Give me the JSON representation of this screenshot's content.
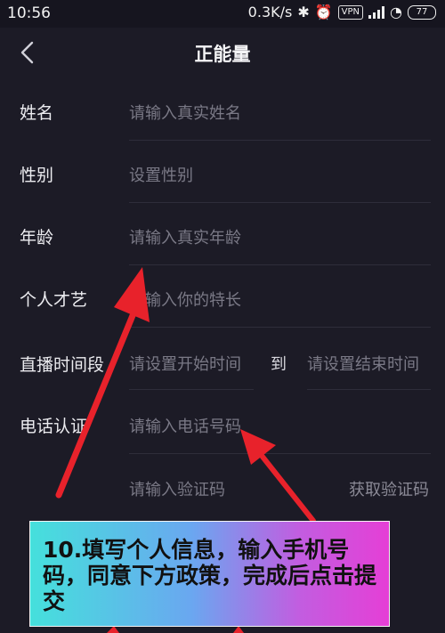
{
  "status_bar": {
    "time": "10:56",
    "speed": "0.3K/s",
    "vpn": "VPN",
    "battery": "77"
  },
  "header": {
    "title": "正能量"
  },
  "form": {
    "name": {
      "label": "姓名",
      "placeholder": "请输入真实姓名"
    },
    "gender": {
      "label": "性别",
      "placeholder": "设置性别"
    },
    "age": {
      "label": "年龄",
      "placeholder": "请输入真实年龄"
    },
    "talent": {
      "label": "个人才艺",
      "placeholder": "请输入你的特长"
    },
    "live_time": {
      "label": "直播时间段",
      "start_placeholder": "请设置开始时间",
      "to": "到",
      "end_placeholder": "请设置结束时间"
    },
    "phone": {
      "label": "电话认证",
      "placeholder": "请输入电话号码"
    },
    "code": {
      "placeholder": "请输入验证码",
      "button": "获取验证码"
    }
  },
  "annotation": {
    "text": "10.填写个人信息，输入手机号码，同意下方政策，完成后点击提交",
    "arrow_color": "#e8222b"
  }
}
